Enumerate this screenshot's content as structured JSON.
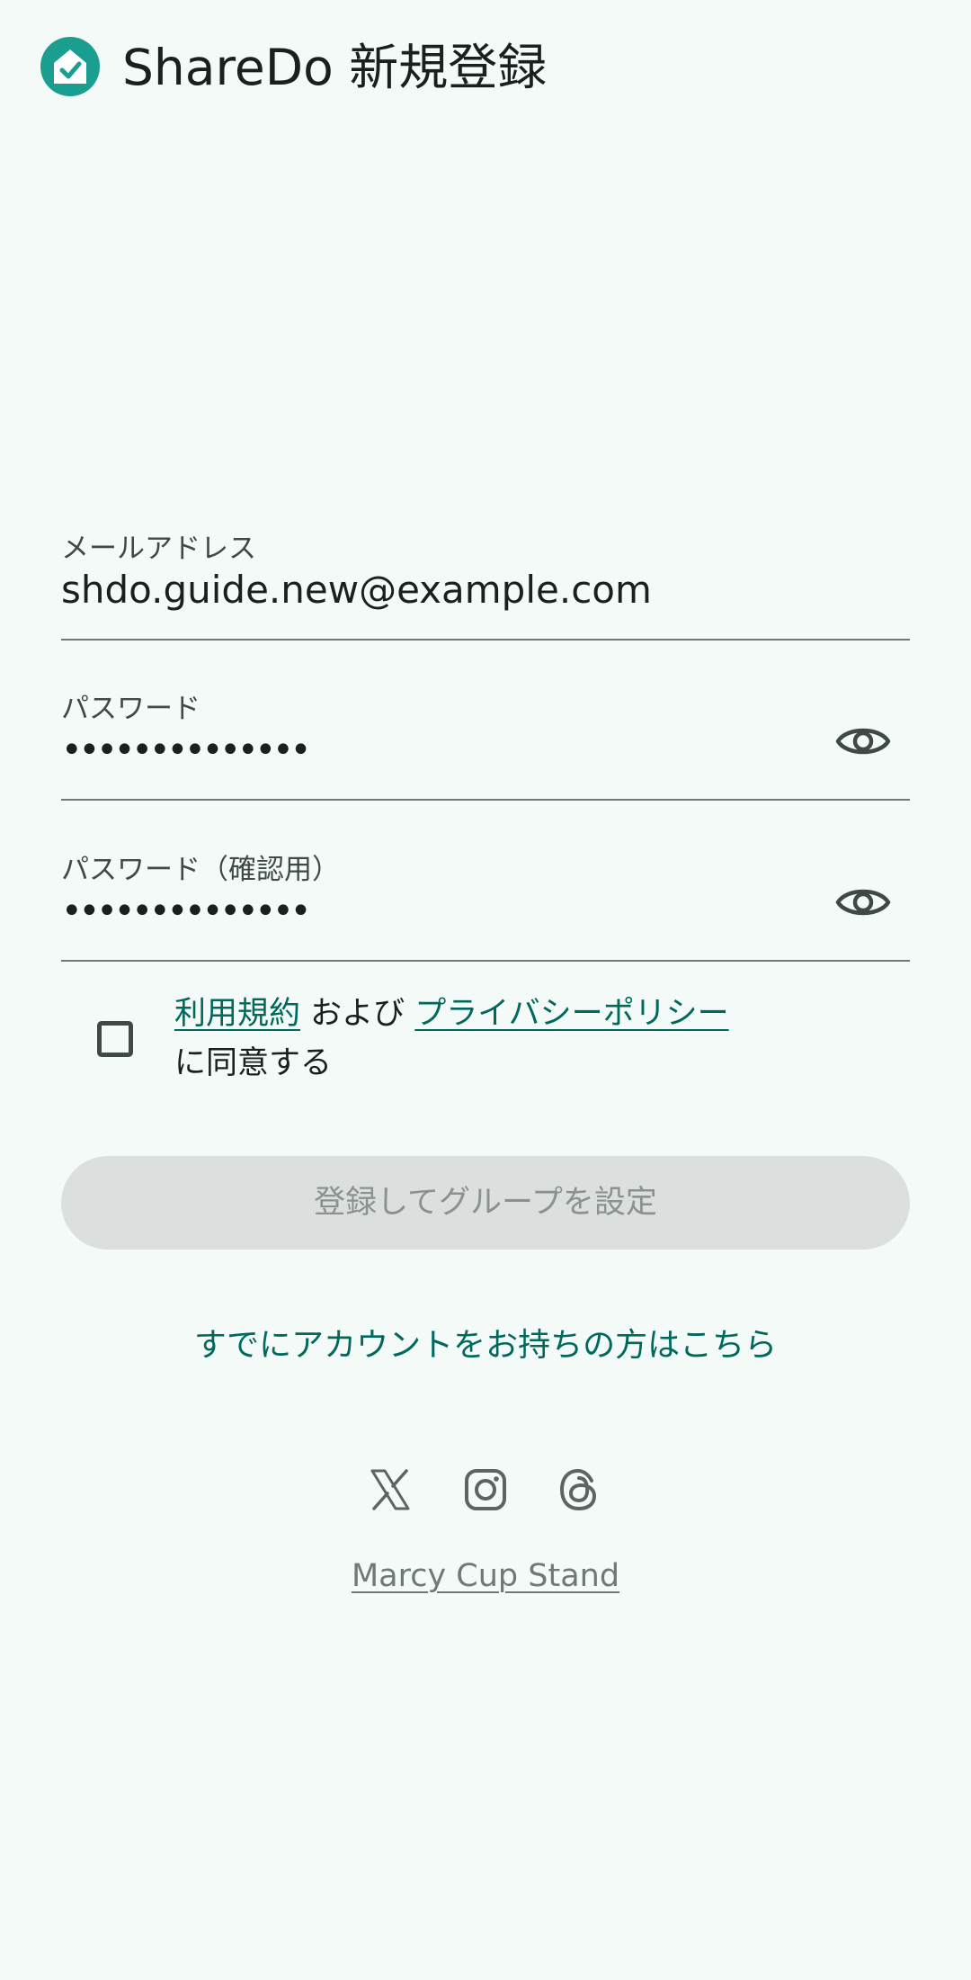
{
  "app_bar": {
    "title": "ShareDo 新規登録",
    "logo_icon": "home-check-icon",
    "brand_color": "#1a9e8f"
  },
  "form": {
    "email": {
      "label": "メールアドレス",
      "value": "shdo.guide.new@example.com"
    },
    "password": {
      "label": "パスワード",
      "value": "••••••••••••••",
      "toggle_icon": "eye-icon"
    },
    "password_confirm": {
      "label": "パスワード（確認用）",
      "value": "••••••••••••••",
      "toggle_icon": "eye-icon"
    },
    "agreement": {
      "terms_link": "利用規約",
      "and_text": " および ",
      "privacy_link": "プライバシーポリシー",
      "suffix": " に同意する",
      "checked": false
    },
    "register_button": "登録してグループを設定"
  },
  "login_link": "すでにアカウントをお持ちの方はこちら",
  "social": {
    "icons": [
      "x-icon",
      "instagram-icon",
      "threads-icon"
    ]
  },
  "credit": "Marcy Cup Stand",
  "colors": {
    "background": "#f4faf7",
    "accent": "#00695c",
    "disabled_button": "#dbe0de"
  }
}
